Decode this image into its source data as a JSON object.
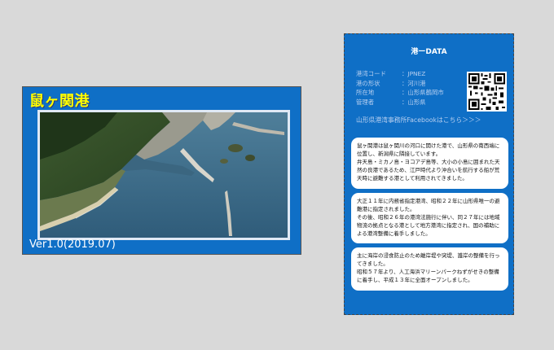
{
  "front": {
    "title": "鼠ヶ関港",
    "version": "Ver1.0(2019.07)"
  },
  "back": {
    "title": "港ーDATA",
    "info": [
      {
        "key": "港湾コード",
        "value": "：JPNEZ"
      },
      {
        "key": "港の形状",
        "value": "：河川港"
      },
      {
        "key": "所在地",
        "value": "：山形県鶴岡市"
      },
      {
        "key": "管理者",
        "value": "：山形県"
      }
    ],
    "facebook_link": "山形県港湾事務所Facebookはこちら＞＞＞",
    "box1": [
      "鼠ヶ関港は鼠ヶ関川の河口に開けた港で、山形県の南西端に位置し、新潟県に隣接しています。",
      "弁天島・ミカノ島・ヨコアデ島等、大小の小島に囲まれた天然の良港であるため、江戸時代より沖合いを航行する船が荒天時に避難する港として利用されてきました。"
    ],
    "box2": [
      "大正１１年に内務省指定港湾、昭和２２年に山形県唯一の避難港に指定されました。",
      "その後、昭和２６年の港湾法施行に伴い、同２７年には地域物流の拠点となる港として地方港湾に指定され、国の補助による港湾整備に着手しました。"
    ],
    "box3": [
      "主に海岸の浸食防止のため離岸堤や突堤、護岸の整備を行ってきました。",
      "昭和５７年より、人工海浜マリーンパークねずがせきの整備に着手し、平成１３年に全面オープンしました。"
    ]
  }
}
